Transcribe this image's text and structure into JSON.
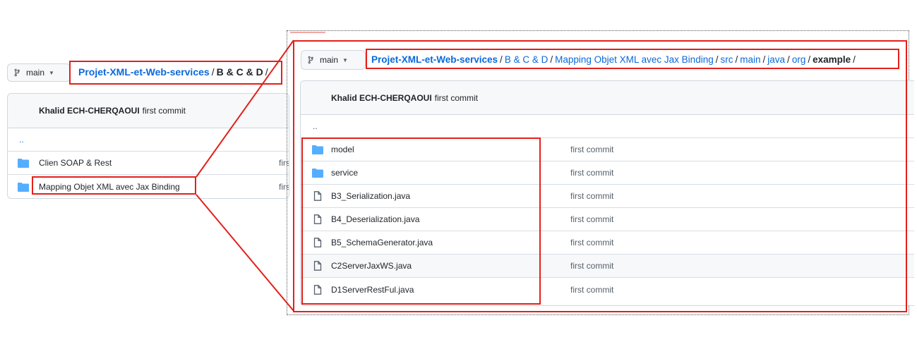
{
  "left": {
    "branch": "main",
    "breadcrumb": {
      "repo": "Projet-XML-et-Web-services",
      "sep": "/",
      "current": "B & C & D",
      "trailing": "/"
    },
    "commit": {
      "author": "Khalid ECH-CHERQAOUI",
      "message": "first commit"
    },
    "parent_link": "..",
    "rows": [
      {
        "name": "Clien SOAP & Rest",
        "commit": "firs"
      },
      {
        "name": "Mapping Objet XML avec Jax Binding",
        "commit": "firs"
      }
    ]
  },
  "right": {
    "branch": "main",
    "breadcrumb": {
      "repo": "Projet-XML-et-Web-services",
      "sep": "/",
      "segments": [
        "B & C & D",
        "Mapping Objet XML avec Jax Binding",
        "src",
        "main",
        "java",
        "org"
      ],
      "current": "example",
      "trailing": "/"
    },
    "commit": {
      "author": "Khalid ECH-CHERQAOUI",
      "message": "first commit"
    },
    "parent_link": "..",
    "rows": [
      {
        "name": "model",
        "type": "folder",
        "commit": "first commit"
      },
      {
        "name": "service",
        "type": "folder",
        "commit": "first commit"
      },
      {
        "name": "B3_Serialization.java",
        "type": "file",
        "commit": "first commit"
      },
      {
        "name": "B4_Deserialization.java",
        "type": "file",
        "commit": "first commit"
      },
      {
        "name": "B5_SchemaGenerator.java",
        "type": "file",
        "commit": "first commit"
      },
      {
        "name": "C2ServerJaxWS.java",
        "type": "file",
        "commit": "first commit"
      },
      {
        "name": "D1ServerRestFul.java",
        "type": "file",
        "commit": "first commit"
      }
    ]
  },
  "colors": {
    "link": "#0969da",
    "highlight": "#e3201b",
    "folder": "#54aeff",
    "border": "#d0d7de"
  },
  "icons": {
    "branch": "git-branch-icon",
    "folder": "folder-icon",
    "file": "file-icon"
  }
}
